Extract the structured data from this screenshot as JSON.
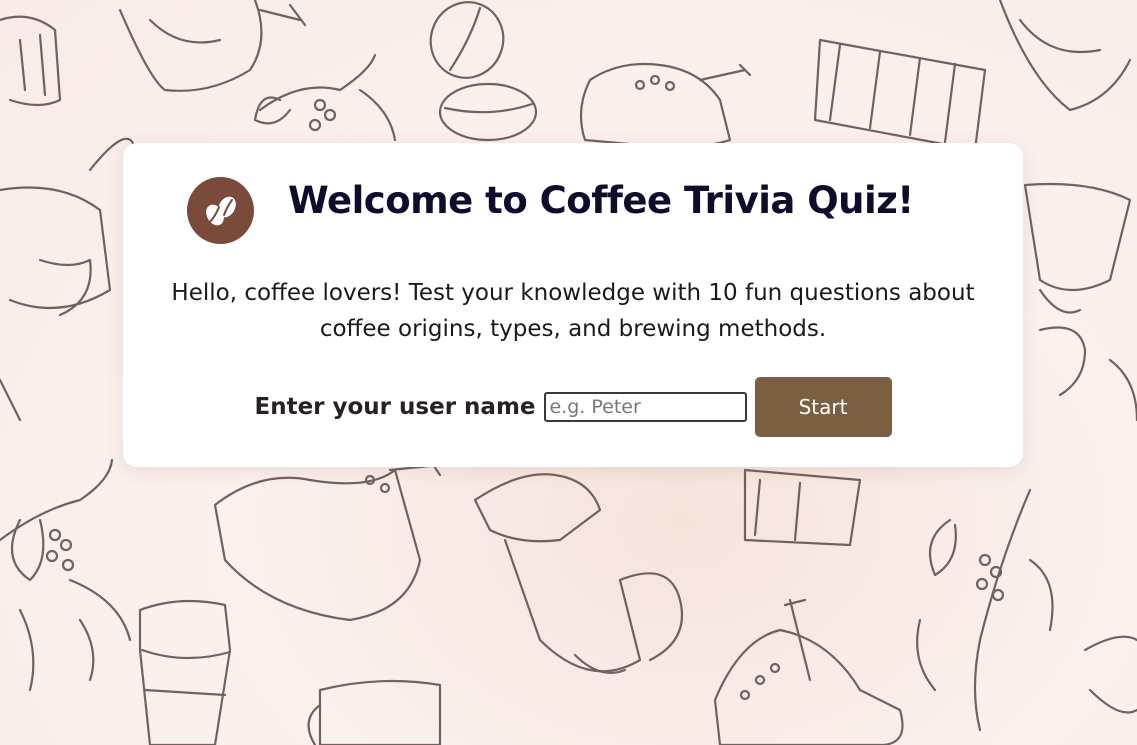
{
  "header": {
    "logo_icon": "coffee-beans-icon",
    "title": "Welcome to Coffee Trivia Quiz!"
  },
  "intro": {
    "line1": "Hello, coffee lovers! Test your knowledge with 10 fun questions about",
    "line2": "coffee origins, types, and brewing methods."
  },
  "form": {
    "name_label": "Enter your user name",
    "name_placeholder": "e.g. Peter",
    "name_value": "",
    "start_label": "Start"
  },
  "colors": {
    "logo_bg": "#7a4a3a",
    "title": "#0d0d2b",
    "button_bg": "#7a6040",
    "sketch_stroke": "#5a4a48"
  }
}
